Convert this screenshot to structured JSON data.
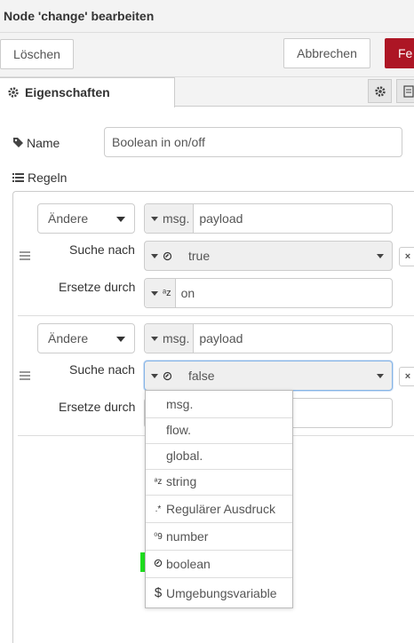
{
  "header": {
    "title": "Node 'change' bearbeiten"
  },
  "toolbar": {
    "delete_label": "Löschen",
    "cancel_label": "Abbrechen",
    "done_label": "Fe"
  },
  "tabs": {
    "properties_label": "Eigenschaften"
  },
  "form": {
    "name_label": "Name",
    "name_value": "Boolean in on/off",
    "rules_label": "Regeln"
  },
  "rules": [
    {
      "action": "Ändere",
      "target_prefix": "msg.",
      "target_value": "payload",
      "search_label": "Suche nach",
      "search_value": "true",
      "replace_label": "Ersetze durch",
      "replace_value": "on",
      "remove": "×"
    },
    {
      "action": "Ändere",
      "target_prefix": "msg.",
      "target_value": "payload",
      "search_label": "Suche nach",
      "search_value": "false",
      "replace_label": "Ersetze durch",
      "remove": "×"
    }
  ],
  "dropdown": {
    "items": [
      {
        "icon": "",
        "label": "msg."
      },
      {
        "icon": "",
        "label": "flow."
      },
      {
        "icon": "",
        "label": "global."
      },
      {
        "icon": "string-icon",
        "label": "string"
      },
      {
        "icon": "regex-icon",
        "label": "Regulärer Ausdruck"
      },
      {
        "icon": "number-icon",
        "label": "number"
      },
      {
        "icon": "boolean-icon",
        "label": "boolean"
      },
      {
        "icon": "dollar-icon",
        "label": "Umgebungsvariable"
      }
    ],
    "highlighted": "boolean",
    "highlight_color": "#1fe01f"
  },
  "colors": {
    "accent": "#ad1625",
    "focus": "#85b4e6"
  }
}
